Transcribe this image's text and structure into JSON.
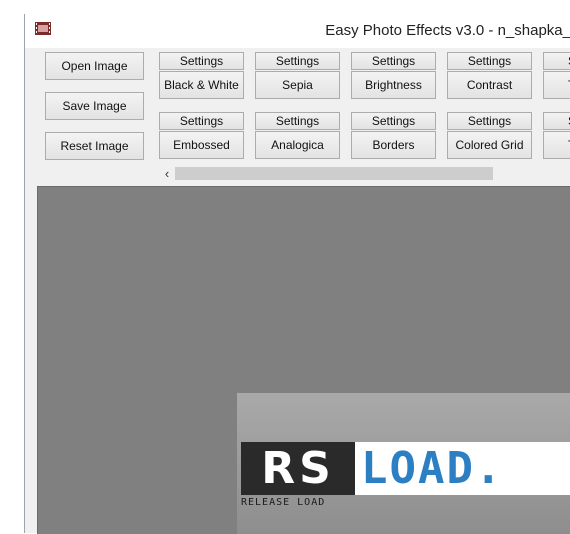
{
  "window": {
    "title": "Easy Photo Effects v3.0 - n_shapka_",
    "app_icon": "film-strip-icon"
  },
  "actions": {
    "open": "Open Image",
    "save": "Save Image",
    "reset": "Reset Image"
  },
  "effects_row1": [
    {
      "settings": "Settings",
      "label": "Black & White"
    },
    {
      "settings": "Settings",
      "label": "Sepia"
    },
    {
      "settings": "Settings",
      "label": "Brightness"
    },
    {
      "settings": "Settings",
      "label": "Contrast"
    },
    {
      "settings": "S",
      "label": "T"
    }
  ],
  "effects_row2": [
    {
      "settings": "Settings",
      "label": "Embossed"
    },
    {
      "settings": "Settings",
      "label": "Analogica"
    },
    {
      "settings": "Settings",
      "label": "Borders"
    },
    {
      "settings": "Settings",
      "label": "Colored Grid"
    },
    {
      "settings": "S",
      "label": "T"
    }
  ],
  "scrollbar": {
    "left_arrow": "‹"
  },
  "image": {
    "logo_left": "RS",
    "logo_right": "LOAD.",
    "tagline": "RELEASE LOAD"
  },
  "colors": {
    "canvas": "#808080",
    "logo_blue": "#2d7fc4"
  }
}
